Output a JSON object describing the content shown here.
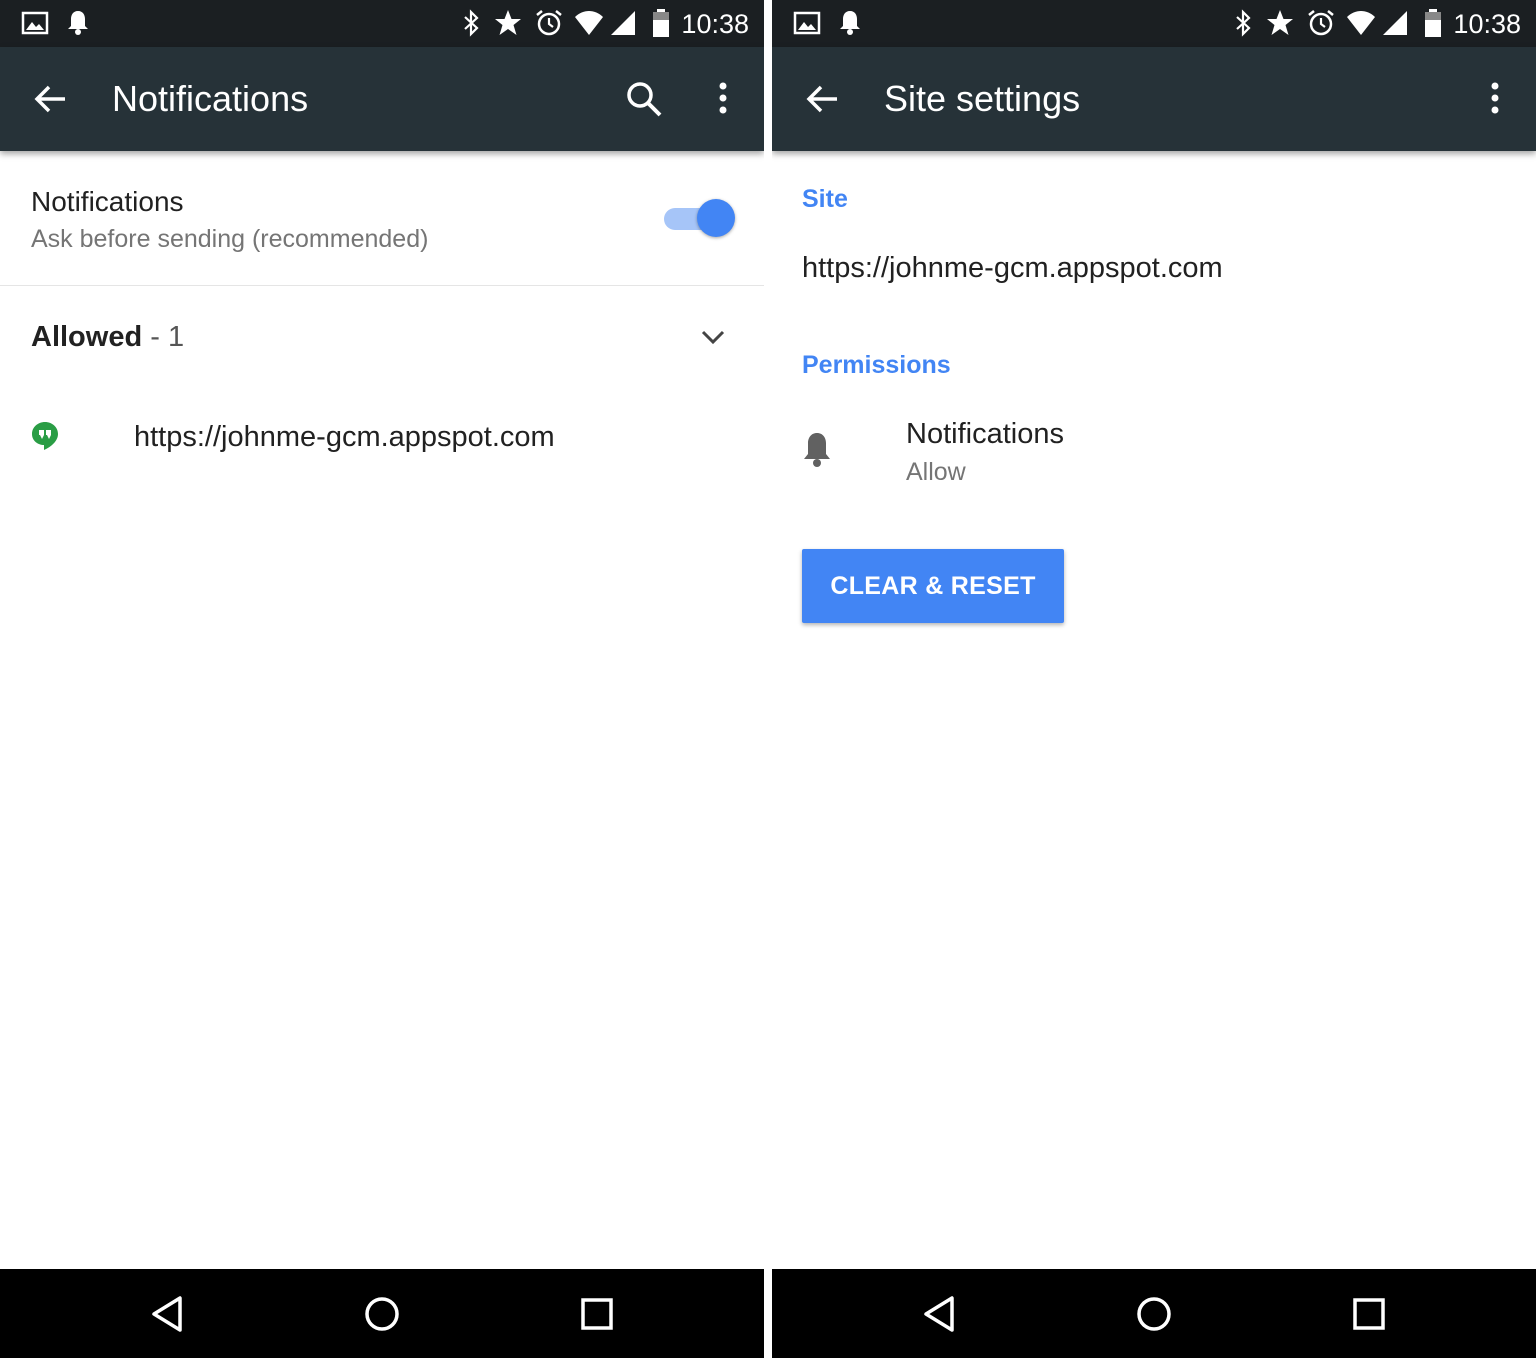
{
  "status_bar": {
    "time": "10:38"
  },
  "left": {
    "toolbar": {
      "title": "Notifications"
    },
    "pref": {
      "title": "Notifications",
      "summary": "Ask before sending (recommended)",
      "enabled": true
    },
    "group": {
      "label": "Allowed",
      "count": " - 1"
    },
    "sites": [
      {
        "url": "https://johnme-gcm.appspot.com",
        "icon": "hangouts-icon"
      }
    ]
  },
  "right": {
    "toolbar": {
      "title": "Site settings"
    },
    "site_section": {
      "label": "Site",
      "url": "https://johnme-gcm.appspot.com"
    },
    "permissions_section": {
      "label": "Permissions"
    },
    "permission": {
      "title": "Notifications",
      "value": "Allow",
      "icon": "bell-icon"
    },
    "reset_button": {
      "label": "CLEAR & RESET"
    }
  },
  "colors": {
    "toolbar": "#263238",
    "status_bar": "#1b1f22",
    "accent": "#4285f4",
    "hangouts": "#2a9d45"
  }
}
